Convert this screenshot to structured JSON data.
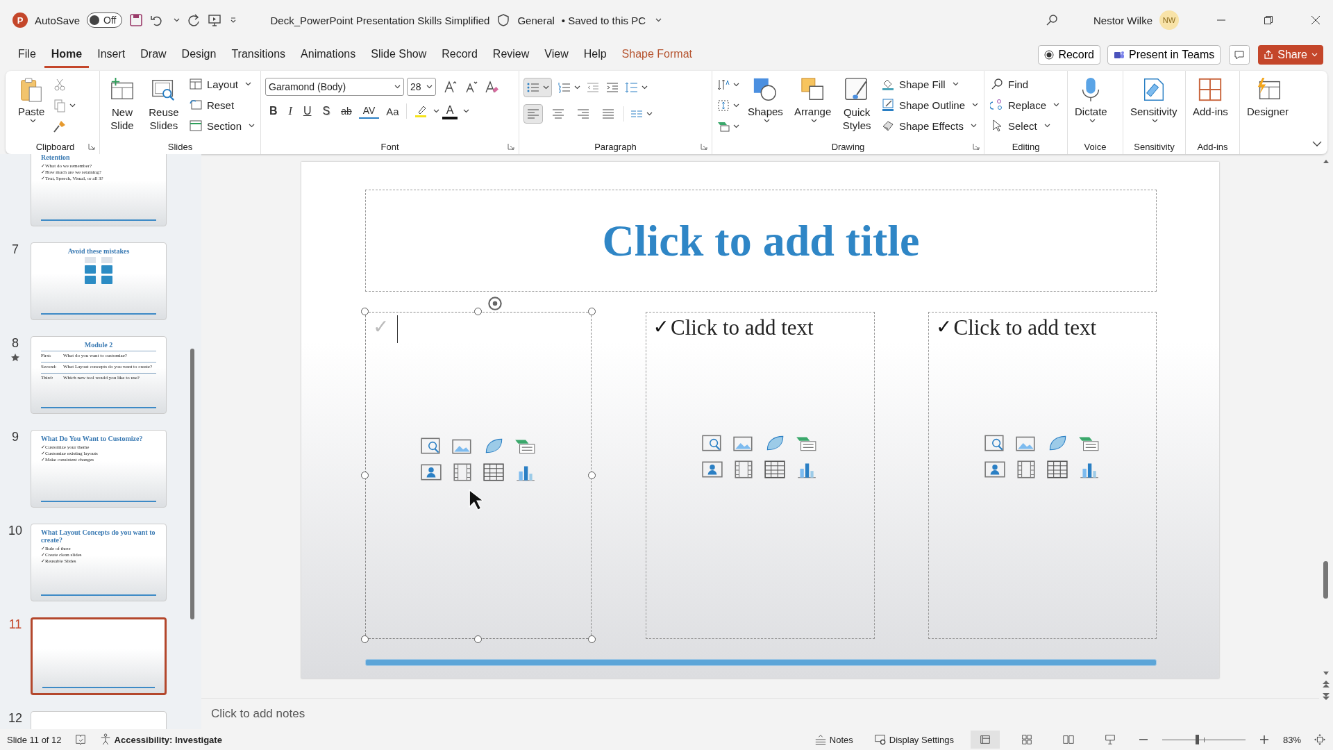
{
  "titlebar": {
    "logo": "P",
    "autosave_label": "AutoSave",
    "autosave": {
      "on": false,
      "label": "Off"
    },
    "document_title": "Deck_PowerPoint Presentation Skills Simplified",
    "sensitivity": "General",
    "save_status": "• Saved to this PC",
    "user_name": "Nestor Wilke",
    "user_initials": "NW"
  },
  "menu_tabs": [
    {
      "label": "File",
      "selected": false,
      "kind": "tab"
    },
    {
      "label": "Home",
      "selected": true,
      "kind": "tab"
    },
    {
      "label": "Insert",
      "selected": false,
      "kind": "tab"
    },
    {
      "label": "Draw",
      "selected": false,
      "kind": "tab"
    },
    {
      "label": "Design",
      "selected": false,
      "kind": "tab"
    },
    {
      "label": "Transitions",
      "selected": false,
      "kind": "tab"
    },
    {
      "label": "Animations",
      "selected": false,
      "kind": "tab"
    },
    {
      "label": "Slide Show",
      "selected": false,
      "kind": "tab"
    },
    {
      "label": "Record",
      "selected": false,
      "kind": "tab"
    },
    {
      "label": "Review",
      "selected": false,
      "kind": "tab"
    },
    {
      "label": "View",
      "selected": false,
      "kind": "tab"
    },
    {
      "label": "Help",
      "selected": false,
      "kind": "tab"
    },
    {
      "label": "Shape Format",
      "selected": false,
      "kind": "contextual"
    }
  ],
  "header_buttons": {
    "record": "Record",
    "teams": "Present in Teams",
    "share": "Share"
  },
  "ribbon": {
    "clipboard": {
      "label": "Clipboard",
      "paste": "Paste"
    },
    "slides": {
      "label": "Slides",
      "new_slide": "New Slide",
      "reuse": "Reuse Slides",
      "layout": "Layout",
      "reset": "Reset",
      "section": "Section"
    },
    "font": {
      "label": "Font",
      "family": "Garamond (Body)",
      "size": "28",
      "formats": [
        {
          "text": "B",
          "kind": "bold"
        },
        {
          "text": "I",
          "kind": "italic"
        },
        {
          "text": "U",
          "kind": "underline"
        },
        {
          "text": "S",
          "kind": "shadow"
        },
        {
          "text": "ab",
          "kind": "strike"
        },
        {
          "text": "AV",
          "kind": "spacing"
        },
        {
          "text": "Aa",
          "kind": "case"
        }
      ],
      "font_color": "A"
    },
    "paragraph": {
      "label": "Paragraph",
      "bullets_on": true,
      "align": [
        {
          "selected": true
        },
        {
          "selected": false
        },
        {
          "selected": false
        },
        {
          "selected": false
        }
      ]
    },
    "drawing": {
      "label": "Drawing",
      "shapes": "Shapes",
      "arrange": "Arrange",
      "quick_styles": "Quick Styles",
      "fill": "Shape Fill",
      "outline": "Shape Outline",
      "effects": "Shape Effects"
    },
    "editing": {
      "label": "Editing",
      "find": "Find",
      "replace": "Replace",
      "select": "Select"
    },
    "voice": {
      "label": "Voice",
      "dictate": "Dictate"
    },
    "sensitivity": {
      "label": "Sensitivity",
      "button": "Sensitivity"
    },
    "addins": {
      "label": "Add-ins",
      "button": "Add-ins"
    },
    "designer": {
      "button": "Designer"
    }
  },
  "slides": [
    {
      "kind": "bullets",
      "selected": false,
      "starred": false,
      "title": "Retention",
      "bullets": [
        "✓What do we remember?",
        "✓How much are we retaining?",
        "✓Text, Speech, Visual, or all 3?"
      ]
    },
    {
      "number": "7",
      "kind": "boxes",
      "selected": false,
      "starred": false,
      "title": "Avoid these mistakes"
    },
    {
      "number": "8",
      "kind": "table",
      "selected": false,
      "starred": true,
      "title": "Module 2",
      "rows": [
        {
          "label": "First:",
          "text": "What do you want to customize?"
        },
        {
          "label": "Second:",
          "text": "What Layout concepts do you want to create?"
        },
        {
          "label": "Third:",
          "text": "Which new tool would you like to use?"
        }
      ]
    },
    {
      "number": "9",
      "kind": "bullets",
      "selected": false,
      "starred": false,
      "title": "What Do You Want to Customize?",
      "bullets": [
        "✓Customize your theme",
        "✓Customize existing layouts",
        "✓Make consistent changes"
      ]
    },
    {
      "number": "10",
      "kind": "bullets",
      "selected": false,
      "starred": false,
      "title": "What Layout Concepts do you want to create?",
      "bullets": [
        "✓Rule of three",
        "✓Create clean slides",
        "✓Reusable Slides"
      ]
    },
    {
      "number": "11",
      "kind": "blank",
      "selected": true,
      "starred": false
    },
    {
      "number": "12",
      "kind": "blank",
      "selected": false,
      "starred": false
    }
  ],
  "slide": {
    "title": "Click to add title",
    "placeholders": [
      {
        "bullet": "✓",
        "selected": true
      },
      {
        "bullet": "✓",
        "text": "Click to add text",
        "selected": false
      },
      {
        "bullet": "✓",
        "text": "Click to add text",
        "selected": false
      }
    ]
  },
  "notes": {
    "placeholder": "Click to add notes"
  },
  "status_bar": {
    "slide_count": "Slide 11 of 12",
    "accessibility": "Accessibility: Investigate",
    "notes": "Notes",
    "display_settings": "Display Settings",
    "views": [
      {
        "selected": true
      },
      {
        "selected": false
      },
      {
        "selected": false
      },
      {
        "selected": false
      }
    ],
    "zoom": {
      "level": 0.42
    },
    "zoom_text": "83%"
  }
}
